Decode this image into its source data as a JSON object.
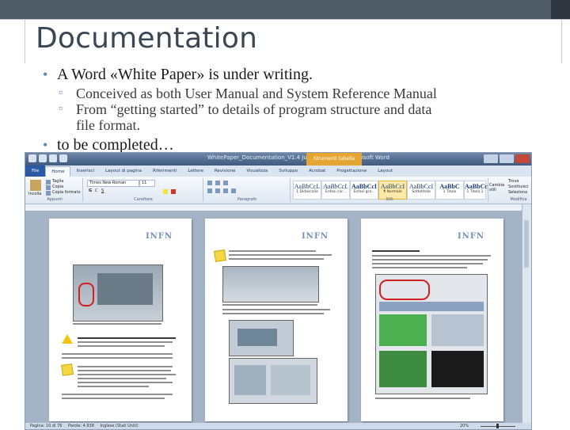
{
  "slide": {
    "title": "Documentation",
    "bullets": [
      {
        "text": "A Word «White Paper» is under writing.",
        "sub": [
          "Conceived as both User Manual and System Reference Manual",
          "From “getting started” to details of program structure and data",
          "file format."
        ]
      },
      {
        "text": "to be completed…"
      }
    ]
  },
  "word": {
    "window_title": "WhitePaper_Documentation_V1.4 July 2012.docx - Microsoft Word",
    "contextual_tab": "Strumenti tabella",
    "tabs": [
      "File",
      "Home",
      "Inserisci",
      "Layout di pagina",
      "Riferimenti",
      "Lettere",
      "Revisione",
      "Visualizza",
      "Sviluppo",
      "Acrobat",
      "Progettazione",
      "Layout"
    ],
    "active_tab": "Home",
    "clipboard": {
      "paste": "Incolla",
      "cut": "Taglia",
      "copy": "Copia",
      "format_painter": "Copia formato",
      "label": "Appunti"
    },
    "font": {
      "name": "Times New Roman",
      "size": "11",
      "label": "Carattere"
    },
    "paragraph_label": "Paragrafo",
    "styles": [
      {
        "sample": "AaBbCcL",
        "name": "1 Didascalia"
      },
      {
        "sample": "AaBbCcL",
        "name": "Enfasi cor..."
      },
      {
        "sample": "AaBbCcI",
        "name": "Enfasi gra..."
      },
      {
        "sample": "AaBbCcI",
        "name": "¶ Normale"
      },
      {
        "sample": "AaBbCcI",
        "name": "Sottotitolo"
      },
      {
        "sample": "AaBbC",
        "name": "1 Titolo"
      },
      {
        "sample": "AaBbCc",
        "name": "1 Titolo 1"
      },
      {
        "sample": "AaBbCc",
        "name": "1 Titolo 2"
      }
    ],
    "styles_label": "Stili",
    "change_styles": "Cambia stili",
    "editing": {
      "find": "Trova",
      "replace": "Sostituisci",
      "select": "Seleziona",
      "label": "Modifica"
    },
    "status": {
      "page": "Pagina: 10 di 76",
      "words": "Parole: 4.938",
      "language": "Inglese (Stati Uniti)",
      "zoom": "20%"
    }
  },
  "pages": [
    {
      "logo": "INFN",
      "caption": "The main panel of the alarm region generator in Reflex.ini"
    },
    {
      "logo": "INFN",
      "caption": "From the menu bar ..."
    },
    {
      "logo": "INFN",
      "heading": "Configuring the DAS"
    }
  ]
}
